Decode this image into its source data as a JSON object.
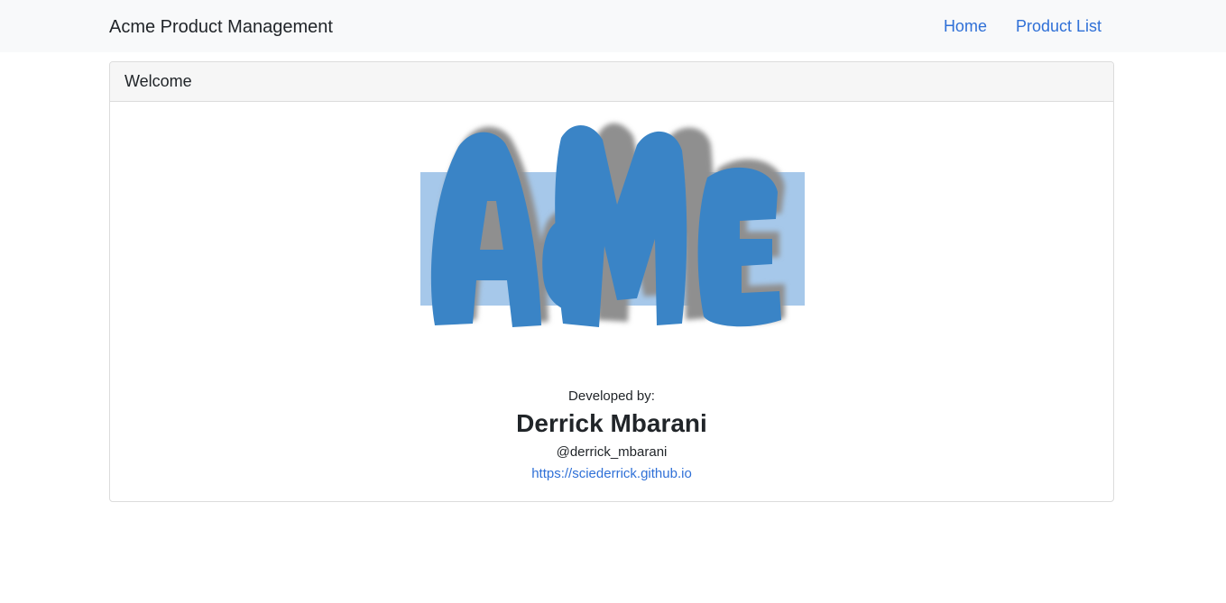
{
  "navbar": {
    "brand": "Acme Product Management",
    "links": [
      {
        "label": "Home"
      },
      {
        "label": "Product List"
      }
    ]
  },
  "welcome_card": {
    "header": "Welcome",
    "logo_text": "AcMe",
    "developed_by_label": "Developed by:",
    "developer_name": "Derrick Mbarani",
    "developer_handle": "@derrick_mbarani",
    "developer_url": "https://sciederrick.github.io"
  },
  "colors": {
    "navbar_bg": "#f8f9fa",
    "link": "#2f70d7",
    "logo_blue": "#3a84c6",
    "logo_band": "#a6c8ea",
    "logo_shadow": "#8f8f8f"
  }
}
